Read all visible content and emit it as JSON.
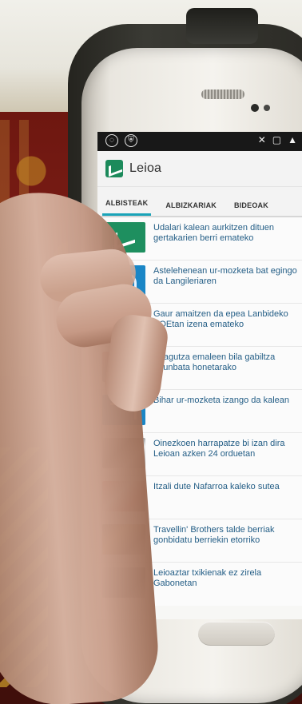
{
  "app": {
    "title": "Leioa",
    "tabs": [
      "ALBISTEAK",
      "ALBIZKARIAK",
      "BIDEOAK"
    ],
    "active_tab_index": 0
  },
  "statusbar": {
    "left_icons": [
      "whatsapp-icon",
      "shield-icon"
    ],
    "right_icons": [
      "mute-icon",
      "cast-icon",
      "signal-icon"
    ]
  },
  "news": [
    {
      "title": "Udalari kalean aurkitzen dituen gertakarien berri emateko",
      "thumb": "logo"
    },
    {
      "title": "Astelehenean ur-mozketa bat egingo da Langileriaren",
      "thumb": "pipe"
    },
    {
      "title": "Gaur amaitzen da epea Lanbideko BOEtan izena emateko",
      "thumb": "photo1"
    },
    {
      "title": "Ezagutza emaleen bila gabiltza larunbata honetarako",
      "thumb": "photo2"
    },
    {
      "title": "Bihar ur-mozketa izango da kalean",
      "thumb": "pipe"
    },
    {
      "title": "Oinezkoen harrapatze bi izan dira Leioan azken 24 orduetan",
      "thumb": "photo3"
    },
    {
      "title": "Itzali dute Nafarroa kaleko sutea",
      "thumb": "photo4"
    },
    {
      "title": "Travellin' Brothers talde berriak gonbidatu berriekin etorriko",
      "thumb": "photo5"
    },
    {
      "title": "Leioaztar txikienak ez zirela Gabonetan",
      "thumb": "photo6"
    }
  ],
  "colors": {
    "accent": "#1aa3b8",
    "link": "#245e86",
    "status_bar": "#181818"
  }
}
